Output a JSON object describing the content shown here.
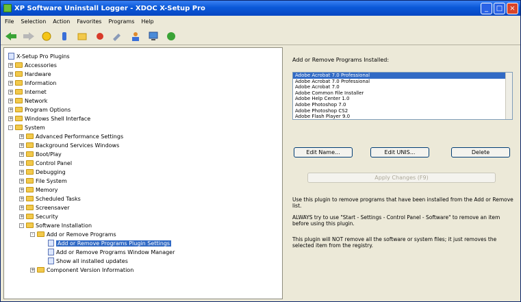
{
  "title": "XP Software Uninstall Logger - XDOC X-Setup Pro",
  "window_buttons": {
    "minimize": "_",
    "maximize": "□",
    "close": "×"
  },
  "menu": [
    "File",
    "Selection",
    "Action",
    "Favorites",
    "Programs",
    "Help"
  ],
  "toolbar_icons": [
    "back-icon",
    "forward-icon",
    "refresh-icon",
    "info-icon",
    "favorite-icon",
    "record-icon",
    "tools-icon",
    "users-icon",
    "network-icon",
    "settings-icon"
  ],
  "tree": {
    "root": "X-Setup Pro Plugins",
    "items": [
      {
        "label": "Accessories",
        "pm": "+"
      },
      {
        "label": "Hardware",
        "pm": "+"
      },
      {
        "label": "Information",
        "pm": "+"
      },
      {
        "label": "Internet",
        "pm": "+"
      },
      {
        "label": "Network",
        "pm": "+"
      },
      {
        "label": "Program Options",
        "pm": "+"
      },
      {
        "label": "Windows Shell Interface",
        "pm": "+"
      },
      {
        "label": "System",
        "pm": "-"
      },
      {
        "label": "Advanced Performance Settings",
        "pm": "+"
      },
      {
        "label": "Background Services Windows",
        "pm": "+"
      },
      {
        "label": "Boot/Play",
        "pm": "+"
      },
      {
        "label": "Control Panel",
        "pm": "+"
      },
      {
        "label": "Debugging",
        "pm": "+"
      },
      {
        "label": "File System",
        "pm": "+"
      },
      {
        "label": "Memory",
        "pm": "+"
      },
      {
        "label": "Scheduled Tasks",
        "pm": "+"
      },
      {
        "label": "Screensaver",
        "pm": "+"
      },
      {
        "label": "Security",
        "pm": "+"
      },
      {
        "label": "Software Installation",
        "pm": "-"
      },
      {
        "label": "Add or Remove Programs",
        "pm": "-"
      },
      {
        "label": "Add or Remove Programs Plugin Settings",
        "pm": ""
      },
      {
        "label": "Add or Remove Programs Window Manager",
        "pm": ""
      },
      {
        "label": "Show all installed updates",
        "pm": ""
      },
      {
        "label": "Component Version Information",
        "pm": "+"
      }
    ]
  },
  "right": {
    "list_title": "Add or Remove Programs Installed:",
    "programs": [
      "Adobe Acrobat 7.0 Professional",
      "Adobe Acrobat 7.0 Professional",
      "Adobe Acrobat 7.0",
      "Adobe Common File Installer",
      "Adobe Help Center 1.0",
      "Adobe Photoshop 7.0",
      "Adobe Photoshop CS2",
      "Adobe Flash Player 9.0"
    ],
    "buttons": {
      "edit_name": "Edit Name...",
      "edit_uninstall": "Edit UNIS...",
      "delete": "Delete"
    },
    "apply": "Apply Changes (F9)",
    "description": [
      "Use this plugin to remove programs that have been installed from the Add or Remove list.",
      "ALWAYS try to use \"Start - Settings - Control Panel - Software\" to remove an item before using this plugin.",
      "This plugin will NOT remove all the software or system files; it just removes the selected item from the registry."
    ]
  },
  "colors": {
    "titlebar": "#0a58d8",
    "selection": "#316ac5",
    "folder": "#f2c94c"
  }
}
